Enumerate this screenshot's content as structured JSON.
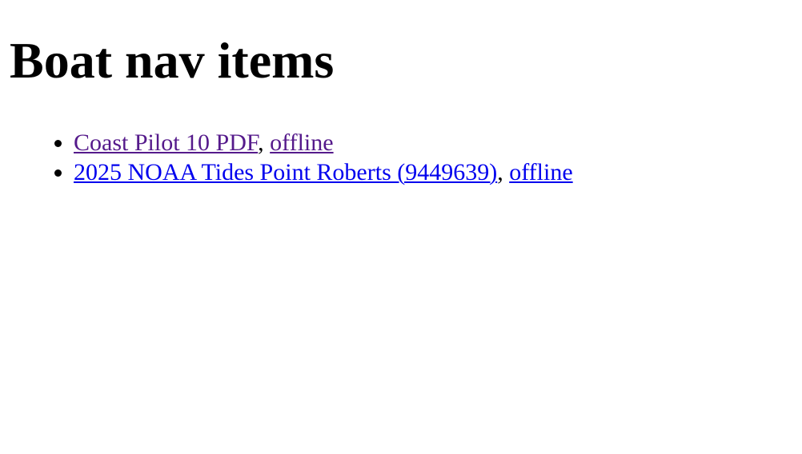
{
  "page": {
    "title": "Boat nav items"
  },
  "items": [
    {
      "link_label": "Coast Pilot 10 PDF",
      "separator": ", ",
      "offline_label": "offline",
      "link_color": "#551a8b",
      "offline_color": "#551a8b"
    },
    {
      "link_label": "2025 NOAA Tides Point Roberts (9449639)",
      "separator": ", ",
      "offline_label": "offline",
      "link_color": "#0000ee",
      "offline_color": "#0000ee"
    }
  ]
}
